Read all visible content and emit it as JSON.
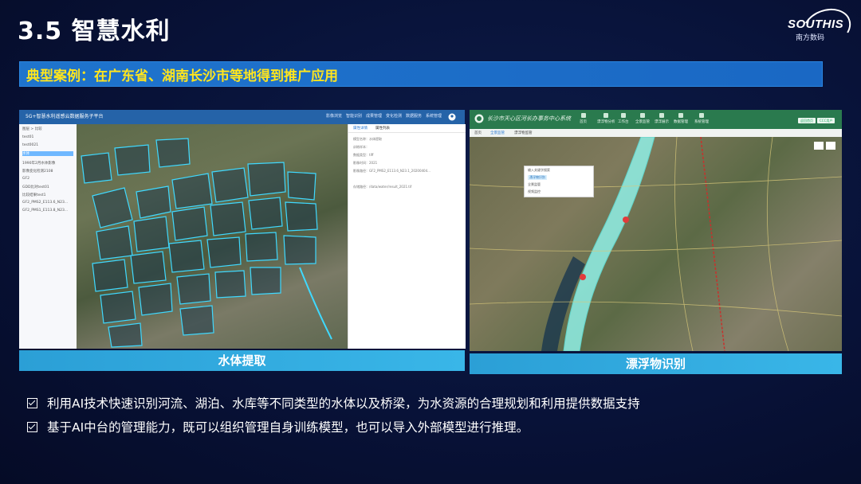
{
  "title": "3.5 智慧水利",
  "logo": {
    "word": "SOUTHIS",
    "sub": "南方数码"
  },
  "banner": "典型案例：在广东省、湖南长沙市等地得到推广应用",
  "left_panel": {
    "app_title": "5G+智慧水利遥感云数据服务子平台",
    "nav": [
      "影像浏览",
      "智能识别",
      "成果管理",
      "变化检测",
      "数据服务",
      "系统管理"
    ],
    "sidebar": [
      "图层  >  比较",
      "test01",
      "test0021",
      "水体",
      "1990年2月水体影像",
      "影像变化检测2108",
      "GF2",
      "GDD比对test01",
      "比较结果test1",
      "GF2_PMS2_E113.6_N23...",
      "GF2_PMS1_E113.8_N23..."
    ],
    "info_tabs": [
      "属性详情",
      "属性列表"
    ],
    "info_rows": [
      "模型名称：水体提取",
      "训练样本：",
      "数据类型：tiff",
      "影像时间：2021",
      "影像路径：GF2_PMS2_E113.6_N23.1_20200404...",
      "",
      "存储路径：/data/water/result_2021.tif"
    ],
    "caption": "水体提取"
  },
  "right_panel": {
    "app_title": "长沙市天心区河长办事务中心系统",
    "nav": [
      "首页",
      "漂浮物分析",
      "工作台",
      "全景监管",
      "漂浮展示",
      "数据管理",
      "系统管理"
    ],
    "buttons": [
      "返回首页",
      "CCC用户"
    ],
    "tabs": [
      "首页",
      "全景监管",
      "漂浮物监管"
    ],
    "dropdown": [
      "输入关键字搜索",
      "漂浮物识别",
      "全景监管",
      "视频监控"
    ],
    "caption": "漂浮物识别"
  },
  "bullets": [
    "利用AI技术快速识别河流、湖泊、水库等不同类型的水体以及桥梁，为水资源的合理规划和利用提供数据支持",
    "基于AI中台的管理能力，既可以组织管理自身训练模型，也可以导入外部模型进行推理。"
  ]
}
